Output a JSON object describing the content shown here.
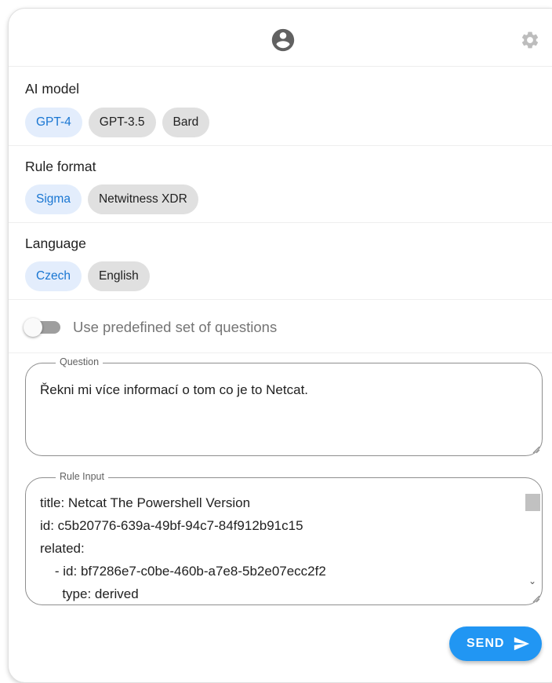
{
  "ai_model": {
    "label": "AI model",
    "options": [
      "GPT-4",
      "GPT-3.5",
      "Bard"
    ],
    "selected": "GPT-4"
  },
  "rule_format": {
    "label": "Rule format",
    "options": [
      "Sigma",
      "Netwitness XDR"
    ],
    "selected": "Sigma"
  },
  "language": {
    "label": "Language",
    "options": [
      "Czech",
      "English"
    ],
    "selected": "Czech"
  },
  "predefined_toggle": {
    "label": "Use predefined set of questions",
    "checked": false
  },
  "question": {
    "legend": "Question",
    "value": "Řekni mi více informací o tom co je to Netcat."
  },
  "rule_input": {
    "legend": "Rule Input",
    "lines": [
      "title: Netcat The Powershell Version",
      "id: c5b20776-639a-49bf-94c7-84f912b91c15",
      "related:",
      "    - id: bf7286e7-c0be-460b-a7e8-5b2e07ecc2f2",
      "      type: derived"
    ]
  },
  "send": {
    "label": "SEND"
  },
  "colors": {
    "accent": "#2196f3",
    "selected_chip_bg": "#e3edfc",
    "selected_chip_text": "#1976d2"
  }
}
